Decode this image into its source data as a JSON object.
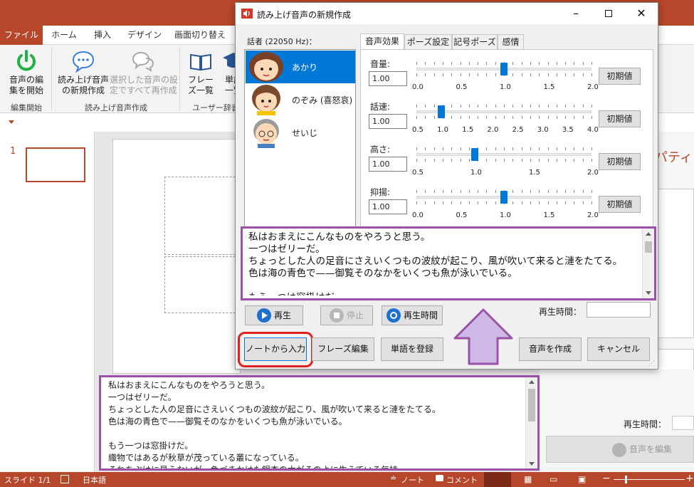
{
  "ribbon": {
    "tabs": [
      "ファイル",
      "ホーム",
      "挿入",
      "デザイン",
      "画面切り替え"
    ],
    "buttons": {
      "start_edit": "音声の編\n集を開始",
      "new_reading": "読み上げ音声\nの新規作成",
      "create_all": "選択した音声の設\n定ですべて再作成",
      "phrase_list": "フレー\nズ一覧",
      "word_list": "単語\n一覧"
    },
    "groups": {
      "edit_start": "編集開始",
      "reading_create": "読み上げ音声作成",
      "user_dict": "ユーザー辞書"
    },
    "qat_icon": "dropdown-arrow-icon"
  },
  "thumbnails": {
    "slide_number": "1"
  },
  "notes": {
    "text": "私はおまえにこんなものをやろうと思う。\n一つはゼリーだ。\nちょっとした人の足音にさえいくつもの波紋が起こり、風が吹いて来ると漣をたてる。\n色は海の青色で——御覧そのなかをいくつも魚が泳いでいる。\n\nもう一つは窓掛けだ。\n織物ではあるが秋草が茂っている叢になっている。\nそれをぶけに見えないが、色づきかけた銀杏の木がそのよに生えている気持"
  },
  "taskpane": {
    "title_fragment": "パティ",
    "play_time_label": "再生時間：",
    "edit_audio_button": "音声を編集"
  },
  "status": {
    "slide": "スライド 1/1",
    "language": "日本語",
    "notes": "ノート",
    "comments": "コメント"
  },
  "dialog": {
    "title": "読み上げ音声の新規作成",
    "speaker_label": "話者 (22050 Hz)：",
    "speakers": [
      "あかり",
      "のぞみ (喜怒哀)",
      "せいじ"
    ],
    "tabs": [
      "音声効果",
      "ポーズ設定",
      "記号ポーズ",
      "感情"
    ],
    "sliders": [
      {
        "label": "音量:",
        "value": "1.00",
        "min": 0.0,
        "max": 2.0,
        "current": 1.0,
        "ticks": [
          "0.0",
          "0.5",
          "1.0",
          "1.5",
          "2.0"
        ]
      },
      {
        "label": "話速:",
        "value": "1.00",
        "min": 0.5,
        "max": 4.0,
        "current": 1.0,
        "ticks": [
          "0.5",
          "1.0",
          "1.5",
          "2.0",
          "2.5",
          "3.0",
          "3.5",
          "4.0"
        ]
      },
      {
        "label": "高さ:",
        "value": "1.00",
        "min": 0.5,
        "max": 2.0,
        "current": 1.0,
        "ticks": [
          "0.5",
          "1.0",
          "1.5",
          "2.0"
        ]
      },
      {
        "label": "抑揚:",
        "value": "1.00",
        "min": 0.0,
        "max": 2.0,
        "current": 1.0,
        "ticks": [
          "0.0",
          "0.5",
          "1.0",
          "1.5",
          "2.0"
        ]
      }
    ],
    "reset_label": "初期値",
    "text": "私はおまえにこんなものをやろうと思う。\n一つはゼリーだ。\nちょっとした人の足音にさえいくつもの波紋が起こり、風が吹いて来ると漣をたてる。\n色は海の青色で——御覧そのなかをいくつも魚が泳いでいる。\n\nもう一つは窓掛けだ。",
    "play_label": "再生",
    "stop_label": "停止",
    "play_time_button": "再生時間",
    "play_time_label": "再生時間：",
    "from_notes": "ノートから入力",
    "phrase_edit": "フレーズ編集",
    "register_word": "単語を登録",
    "create_audio": "音声を作成",
    "cancel": "キャンセル"
  },
  "colors": {
    "accent": "#b7472a",
    "highlight_frame": "#9b51a8",
    "arrow_fill": "#cdb8e6",
    "selected": "#0078d7",
    "red_outline": "#e02020"
  }
}
